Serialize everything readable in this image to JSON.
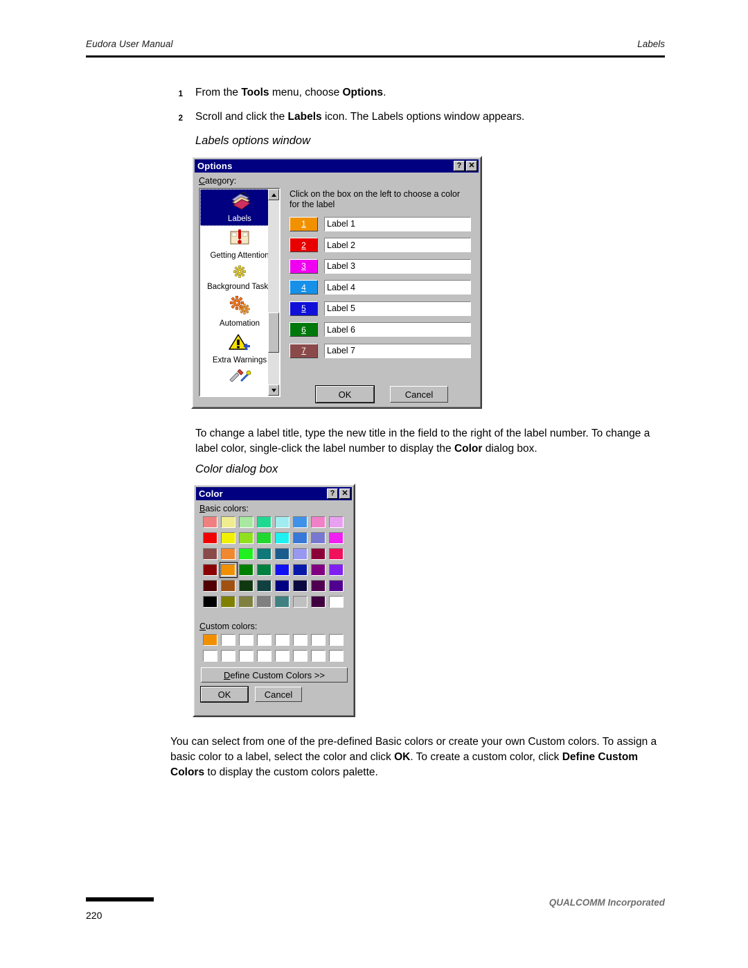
{
  "header": {
    "left": "Eudora User Manual",
    "right": "Labels"
  },
  "steps": [
    {
      "number": "1",
      "parts": [
        {
          "t": "From the ",
          "b": false
        },
        {
          "t": "Tools",
          "b": true
        },
        {
          "t": " menu, choose ",
          "b": false
        },
        {
          "t": "Options",
          "b": true
        },
        {
          "t": ".",
          "b": false
        }
      ]
    },
    {
      "number": "2",
      "parts": [
        {
          "t": "Scroll and click the ",
          "b": false
        },
        {
          "t": "Labels",
          "b": true
        },
        {
          "t": " icon. The Labels options window appears.",
          "b": false
        }
      ]
    }
  ],
  "captions": {
    "labels_window": "Labels options window",
    "color_dialog": "Color dialog box"
  },
  "paragraphs": {
    "change_label": [
      {
        "t": "To change a label title, type the new title in the field to the right of the label number. To change a label color, single-click the label number to display the ",
        "b": false
      },
      {
        "t": "Color",
        "b": true
      },
      {
        "t": " dialog box.",
        "b": false
      }
    ],
    "basic_custom": [
      {
        "t": "You can select from one of the pre-defined Basic colors or create your own Custom colors. To assign a basic color to a label, select the color and click ",
        "b": false
      },
      {
        "t": "OK",
        "b": true
      },
      {
        "t": ". To create a custom color, click ",
        "b": false
      },
      {
        "t": "Define Custom Colors",
        "b": true
      },
      {
        "t": " to display the custom colors palette.",
        "b": false
      }
    ]
  },
  "options_dialog": {
    "title": "Options",
    "help_button": "?",
    "close_button": "✕",
    "category_label_pre": "C",
    "category_label_post": "ategory:",
    "instruction": "Click on the box on the left to choose a color for the label",
    "categories": [
      {
        "label": "Labels",
        "icon": "labels-icon",
        "selected": true
      },
      {
        "label": "Getting Attention",
        "icon": "getting-attention-icon",
        "selected": false
      },
      {
        "label": "Background Tasks",
        "icon": "background-tasks-icon",
        "selected": false
      },
      {
        "label": "Automation",
        "icon": "automation-icon",
        "selected": false
      },
      {
        "label": "Extra Warnings",
        "icon": "extra-warnings-icon",
        "selected": false
      },
      {
        "label": "",
        "icon": "tools-icon",
        "selected": false
      }
    ],
    "labels": [
      {
        "number": "1",
        "color": "#f29100",
        "title": "Label 1"
      },
      {
        "number": "2",
        "color": "#e80000",
        "title": "Label 2"
      },
      {
        "number": "3",
        "color": "#f000f0",
        "title": "Label 3"
      },
      {
        "number": "4",
        "color": "#1790e8",
        "title": "Label 4"
      },
      {
        "number": "5",
        "color": "#1010d8",
        "title": "Label 5"
      },
      {
        "number": "6",
        "color": "#00780c",
        "title": "Label 6"
      },
      {
        "number": "7",
        "color": "#8b4a4a",
        "title": "Label 7"
      }
    ],
    "ok_label": "OK",
    "cancel_label": "Cancel",
    "scrollbar": {
      "up_arrow": "▲",
      "down_arrow": "▼"
    }
  },
  "color_dialog": {
    "title": "Color",
    "help_button": "?",
    "close_button": "✕",
    "basic_colors_label_pre": "B",
    "basic_colors_label_post": "asic colors:",
    "custom_colors_label_pre": "C",
    "custom_colors_label_post": "ustom colors:",
    "basic_colors": [
      [
        "#f08080",
        "#f0ed90",
        "#a8e8a0",
        "#20d890",
        "#a0ecf0",
        "#3f92e8",
        "#f080c8",
        "#e8a0f0"
      ],
      [
        "#f00000",
        "#f0f000",
        "#90e020",
        "#20d830",
        "#20f0f0",
        "#3878d8",
        "#7878d0",
        "#f020f0"
      ],
      [
        "#8b4a4a",
        "#f08830",
        "#20f020",
        "#107878",
        "#1a5c8c",
        "#9898f0",
        "#8b0038",
        "#f0105c"
      ],
      [
        "#8b0000",
        "#f09000",
        "#008000",
        "#008040",
        "#1010f0",
        "#0818a8",
        "#800080",
        "#8020f0"
      ],
      [
        "#500000",
        "#a05010",
        "#103810",
        "#104040",
        "#000080",
        "#0a0a40",
        "#500050",
        "#500090"
      ],
      [
        "#000000",
        "#808000",
        "#808040",
        "#808080",
        "#408080",
        "#c0c0c0",
        "#400040",
        "#ffffff"
      ]
    ],
    "selected_basic": {
      "row": 3,
      "col": 1
    },
    "custom_colors": [
      [
        "#f09000",
        "#ffffff",
        "#ffffff",
        "#ffffff",
        "#ffffff",
        "#ffffff",
        "#ffffff",
        "#ffffff"
      ],
      [
        "#ffffff",
        "#ffffff",
        "#ffffff",
        "#ffffff",
        "#ffffff",
        "#ffffff",
        "#ffffff",
        "#ffffff"
      ]
    ],
    "define_custom_pre": "D",
    "define_custom_post": "efine Custom Colors >>",
    "ok_label": "OK",
    "cancel_label": "Cancel"
  },
  "footer": {
    "page_number": "220",
    "company": "QUALCOMM Incorporated"
  }
}
